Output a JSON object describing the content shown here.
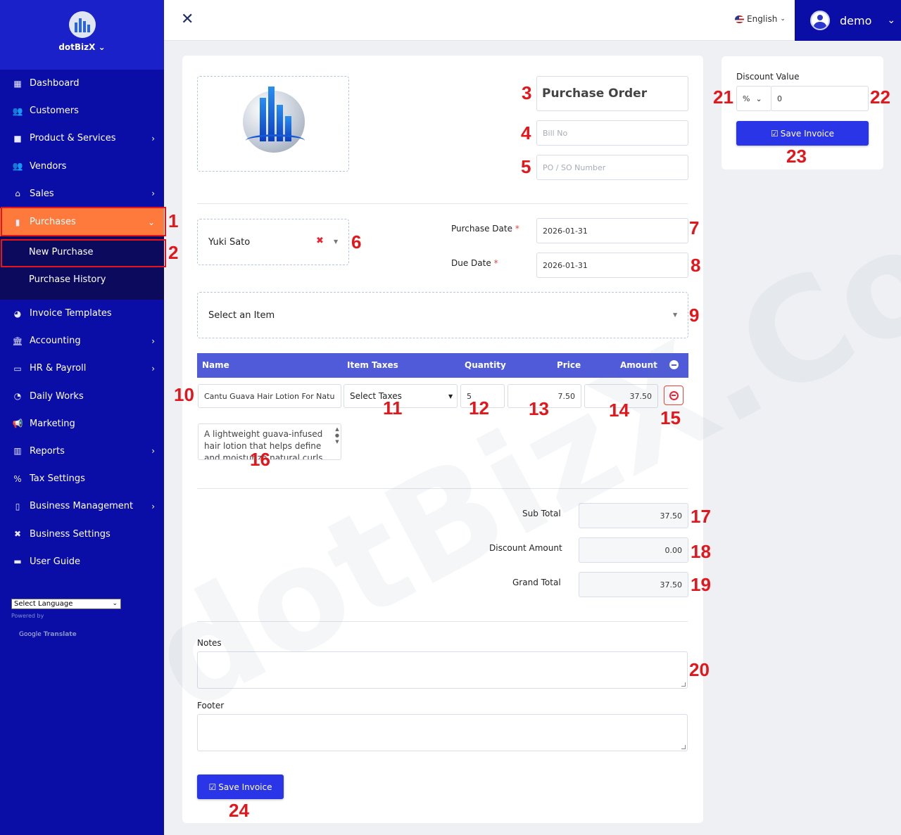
{
  "brand": {
    "name": "dotBizX ⌄"
  },
  "sidebar": {
    "items": [
      {
        "label": "Dashboard",
        "icon": "dashboard-icon",
        "glyph": "▦",
        "chevron": ""
      },
      {
        "label": "Customers",
        "icon": "users-icon",
        "glyph": "👥",
        "chevron": ""
      },
      {
        "label": "Product & Services",
        "icon": "box-icon",
        "glyph": "■",
        "chevron": "›"
      },
      {
        "label": "Vendors",
        "icon": "users-icon",
        "glyph": "👥",
        "chevron": ""
      },
      {
        "label": "Sales",
        "icon": "basket-icon",
        "glyph": "⌂",
        "chevron": "›"
      },
      {
        "label": "Purchases",
        "icon": "bag-icon",
        "glyph": "▮",
        "chevron": "⌄"
      },
      {
        "label": "Invoice Templates",
        "icon": "palette-icon",
        "glyph": "◕",
        "chevron": ""
      },
      {
        "label": "Accounting",
        "icon": "bank-icon",
        "glyph": "🏛",
        "chevron": "›"
      },
      {
        "label": "HR & Payroll",
        "icon": "money-icon",
        "glyph": "▭",
        "chevron": "›"
      },
      {
        "label": "Daily Works",
        "icon": "clock-icon",
        "glyph": "◔",
        "chevron": ""
      },
      {
        "label": "Marketing",
        "icon": "megaphone-icon",
        "glyph": "📢",
        "chevron": ""
      },
      {
        "label": "Reports",
        "icon": "chart-icon",
        "glyph": "▥",
        "chevron": "›"
      },
      {
        "label": "Tax Settings",
        "icon": "percent-icon",
        "glyph": "%",
        "chevron": ""
      },
      {
        "label": "Business Management",
        "icon": "building-icon",
        "glyph": "▯",
        "chevron": "›"
      },
      {
        "label": "Business Settings",
        "icon": "tools-icon",
        "glyph": "✖",
        "chevron": ""
      },
      {
        "label": "User Guide",
        "icon": "book-icon",
        "glyph": "▬",
        "chevron": ""
      }
    ],
    "purchases_sub": [
      "New Purchase",
      "Purchase History"
    ],
    "language_select": "Select Language",
    "powered_by": "Powered by",
    "google": "Google",
    "translate": "Translate"
  },
  "topbar": {
    "language": "English",
    "user": "demo"
  },
  "form": {
    "title": "Purchase Order",
    "bill_no_placeholder": "Bill No",
    "po_placeholder": "PO / SO Number",
    "vendor": "Yuki Sato",
    "purchase_date_label": "Purchase Date",
    "purchase_date": "2026-01-31",
    "due_date_label": "Due Date",
    "due_date": "2026-01-31",
    "item_select": "Select an Item",
    "table_headers": {
      "name": "Name",
      "taxes": "Item Taxes",
      "quantity": "Quantity",
      "price": "Price",
      "amount": "Amount"
    },
    "row": {
      "name": "Cantu Guava Hair Lotion For Natu",
      "taxes": "Select Taxes",
      "quantity": "5",
      "price": "7.50",
      "amount": "37.50",
      "description": "A lightweight guava-infused hair lotion that helps define and moisturize natural curls"
    },
    "sub_total_label": "Sub Total",
    "sub_total": "37.50",
    "discount_amount_label": "Discount Amount",
    "discount_amount": "0.00",
    "grand_total_label": "Grand Total",
    "grand_total": "37.50",
    "notes_label": "Notes",
    "footer_label": "Footer",
    "save_label": "Save Invoice"
  },
  "discount": {
    "label": "Discount Value",
    "type": "%",
    "value": "0",
    "save_label": "Save Invoice"
  },
  "watermark": "dotBizX.Com",
  "annotations": [
    "1",
    "2",
    "3",
    "4",
    "5",
    "6",
    "7",
    "8",
    "9",
    "10",
    "11",
    "12",
    "13",
    "14",
    "15",
    "16",
    "17",
    "18",
    "19",
    "20",
    "21",
    "22",
    "23",
    "24"
  ],
  "colors": {
    "sidebar": "#0a0ea6",
    "active": "#fd7a3c",
    "primary": "#2b35e8",
    "table_header": "#4f5bd9",
    "annotation": "#e3161c"
  }
}
